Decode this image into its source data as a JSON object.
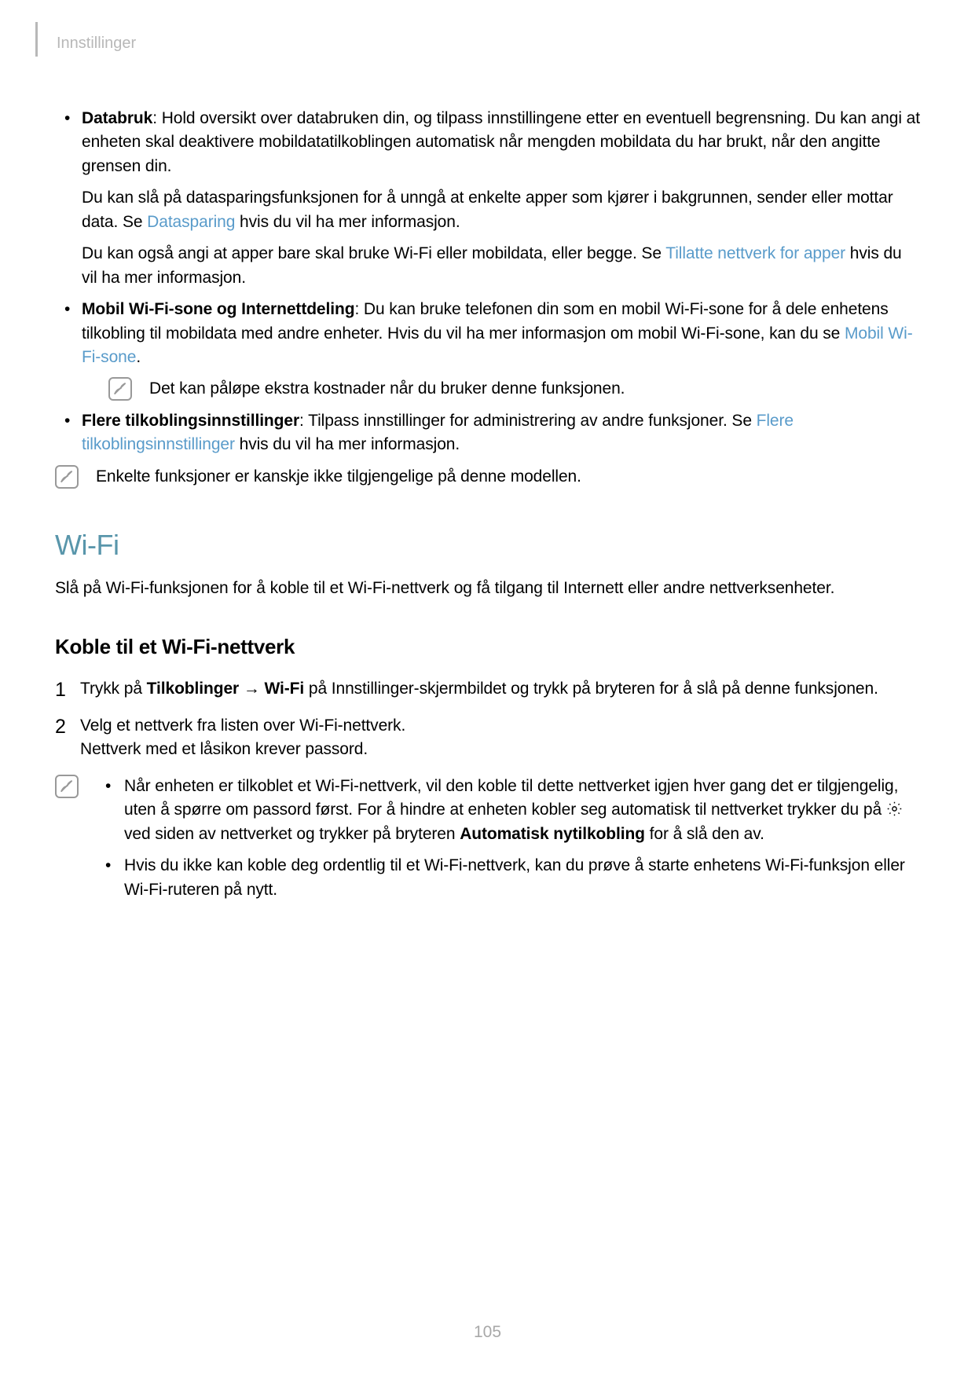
{
  "header": "Innstillinger",
  "b1": {
    "title": "Databruk",
    "p1": ": Hold oversikt over databruken din, og tilpass innstillingene etter en eventuell begrensning. Du kan angi at enheten skal deaktivere mobildatatilkoblingen automatisk når mengden mobildata du har brukt, når den angitte grensen din.",
    "p2a": "Du kan slå på datasparingsfunksjonen for å unngå at enkelte apper som kjører i bakgrunnen, sender eller mottar data. Se ",
    "p2link": "Datasparing",
    "p2b": " hvis du vil ha mer informasjon.",
    "p3a": "Du kan også angi at apper bare skal bruke Wi-Fi eller mobildata, eller begge. Se ",
    "p3link": "Tillatte nettverk for apper",
    "p3b": " hvis du vil ha mer informasjon."
  },
  "b2": {
    "title": "Mobil Wi-Fi-sone og Internettdeling",
    "p1a": ": Du kan bruke telefonen din som en mobil Wi-Fi-sone for å dele enhetens tilkobling til mobildata med andre enheter. Hvis du vil ha mer informasjon om mobil Wi-Fi-sone, kan du se ",
    "p1link": "Mobil Wi-Fi-sone",
    "p1b": ".",
    "note": "Det kan påløpe ekstra kostnader når du bruker denne funksjonen."
  },
  "b3": {
    "title": "Flere tilkoblingsinnstillinger",
    "p1a": ": Tilpass innstillinger for administrering av andre funksjoner. Se ",
    "p1link": "Flere tilkoblingsinnstillinger",
    "p1b": " hvis du vil ha mer informasjon."
  },
  "outerNote": "Enkelte funksjoner er kanskje ikke tilgjengelige på denne modellen.",
  "wifi": {
    "heading": "Wi-Fi",
    "intro": "Slå på Wi-Fi-funksjonen for å koble til et Wi-Fi-nettverk og få tilgang til Internett eller andre nettverksenheter.",
    "sub": "Koble til et Wi-Fi-nettverk",
    "step1": {
      "a": "Trykk på ",
      "b1": "Tilkoblinger",
      "arrow": " → ",
      "b2": "Wi-Fi",
      "c": " på Innstillinger-skjermbildet og trykk på bryteren for å slå på denne funksjonen."
    },
    "step2": {
      "a": "Velg et nettverk fra listen over Wi-Fi-nettverk.",
      "b": "Nettverk med et låsikon krever passord."
    },
    "tip1": {
      "a": "Når enheten er tilkoblet et Wi-Fi-nettverk, vil den koble til dette nettverket igjen hver gang det er tilgjengelig, uten å spørre om passord først. For å hindre at enheten kobler seg automatisk til nettverket trykker du på ",
      "b": " ved siden av nettverket og trykker på bryteren ",
      "bold": "Automatisk nytilkobling",
      "c": " for å slå den av."
    },
    "tip2": "Hvis du ikke kan koble deg ordentlig til et Wi-Fi-nettverk, kan du prøve å starte enhetens Wi-Fi-funksjon eller Wi-Fi-ruteren på nytt."
  },
  "pageNumber": "105"
}
